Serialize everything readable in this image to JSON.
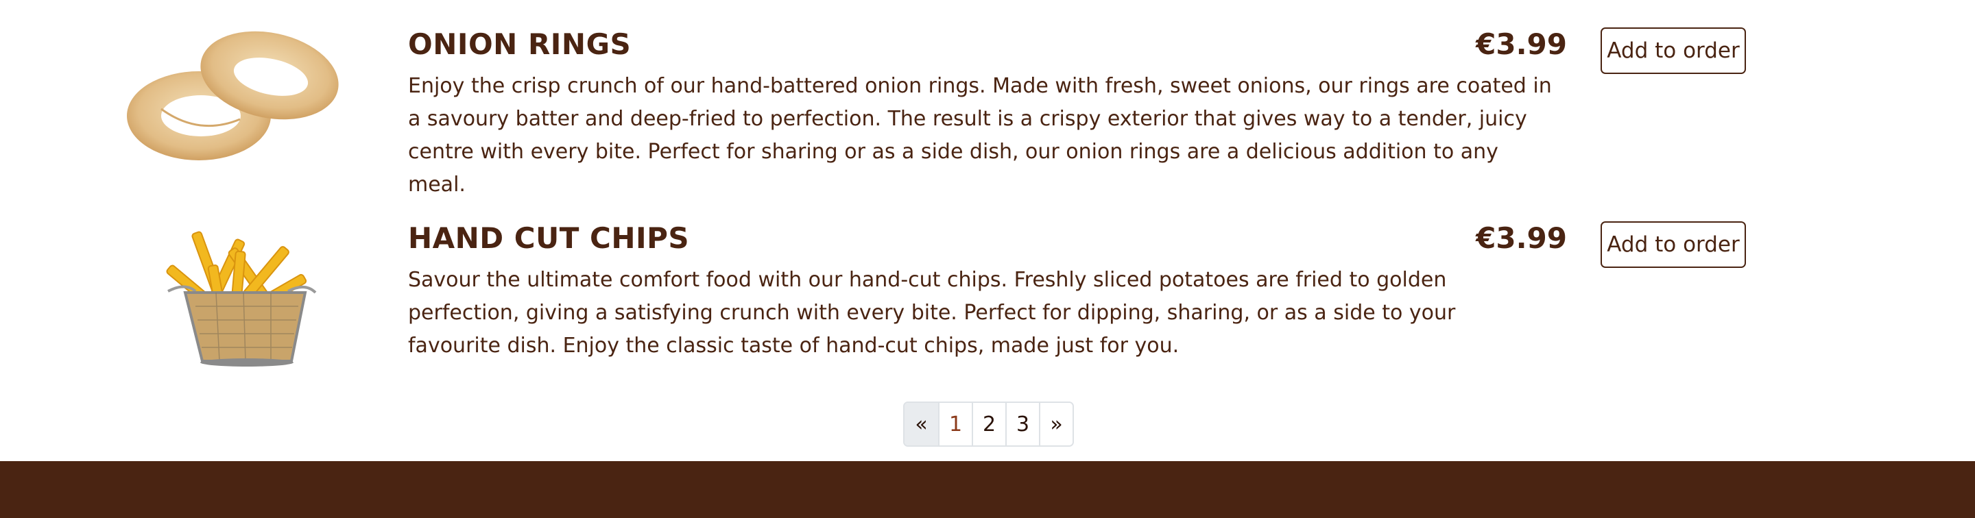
{
  "menu": {
    "items": [
      {
        "title": "ONION RINGS",
        "price": "€3.99",
        "description": "Enjoy the crisp crunch of our hand-battered onion rings. Made with fresh, sweet onions, our rings are coated in a savoury batter and deep-fried to perfection. The result is a crispy exterior that gives way to a tender, juicy centre with every bite. Perfect for sharing or as a side dish, our onion rings are a delicious addition to any meal.",
        "button_label": "Add to order"
      },
      {
        "title": "HAND CUT CHIPS",
        "price": "€3.99",
        "description": "Savour the ultimate comfort food with our hand-cut chips. Freshly sliced potatoes are fried to golden perfection, giving a satisfying crunch with every bite. Perfect for dipping, sharing, or as a side to your favourite dish. Enjoy the classic taste of hand-cut chips, made just for you.",
        "button_label": "Add to order"
      }
    ]
  },
  "pagination": {
    "prev": "«",
    "pages": [
      "1",
      "2",
      "3"
    ],
    "current": "1",
    "next": "»"
  },
  "colors": {
    "brand_brown": "#4a2412",
    "active_page": "#8b3a1a",
    "pagination_border": "#dee2e6",
    "pagination_disabled_bg": "#e9ecef"
  }
}
